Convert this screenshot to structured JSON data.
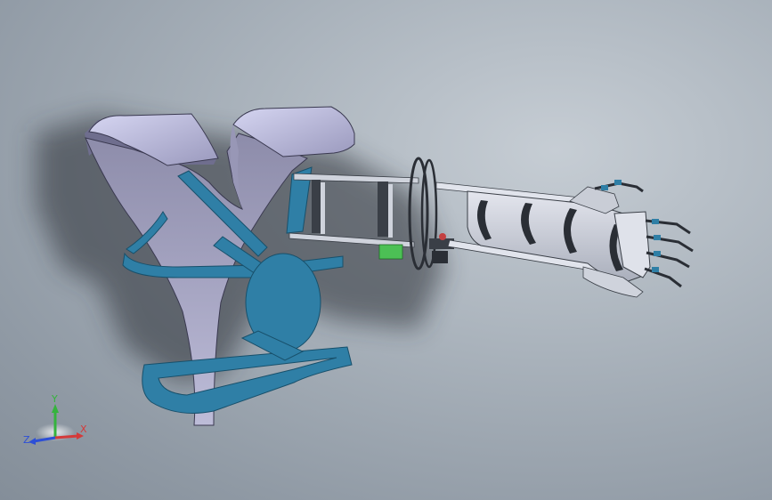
{
  "viewport": {
    "background_color": "#a4adb7"
  },
  "model": {
    "parts": [
      "shoulder-harness",
      "chest-strap",
      "upper-arm-frame",
      "elbow-joint",
      "forearm-brace",
      "hand-mechanism"
    ],
    "colors": {
      "harness_shell": "#c9c9ea",
      "harness_shell_shade": "#7f7e9c",
      "strap_blue": "#2f7fa6",
      "strap_blue_dark": "#1f5f80",
      "metal": "#cfd3dc",
      "metal_dark": "#3a3f47",
      "motor_green": "#4cc055"
    }
  },
  "triad": {
    "x_label": "X",
    "y_label": "Y",
    "z_label": "Z",
    "x_color": "#d43a3a",
    "y_color": "#35b33d",
    "z_color": "#2d4fd6"
  }
}
